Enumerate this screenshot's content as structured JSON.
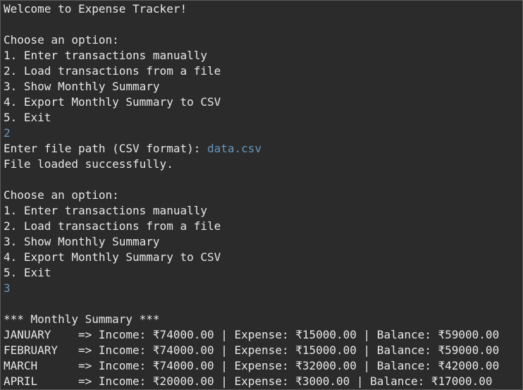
{
  "console": {
    "colors": {
      "background": "#2b2b2b",
      "text": "#e8e8e8",
      "user_input": "#6897bb"
    },
    "welcome": "Welcome to Expense Tracker!",
    "prompt_header": "Choose an option:",
    "options": [
      "1. Enter transactions manually",
      "2. Load transactions from a file",
      "3. Show Monthly Summary",
      "4. Export Monthly Summary to CSV",
      "5. Exit"
    ],
    "input_1": "2",
    "file_prompt": "Enter file path (CSV format): ",
    "file_value": "data.csv",
    "file_loaded": "File loaded successfully.",
    "input_2": "3",
    "summary_title": "*** Monthly Summary ***",
    "summary_rows": [
      "JANUARY    => Income: ₹74000.00 | Expense: ₹15000.00 | Balance: ₹59000.00",
      "FEBRUARY   => Income: ₹74000.00 | Expense: ₹15000.00 | Balance: ₹59000.00",
      "MARCH      => Income: ₹74000.00 | Expense: ₹32000.00 | Balance: ₹42000.00",
      "APRIL      => Income: ₹20000.00 | Expense: ₹3000.00 | Balance: ₹17000.00"
    ]
  }
}
